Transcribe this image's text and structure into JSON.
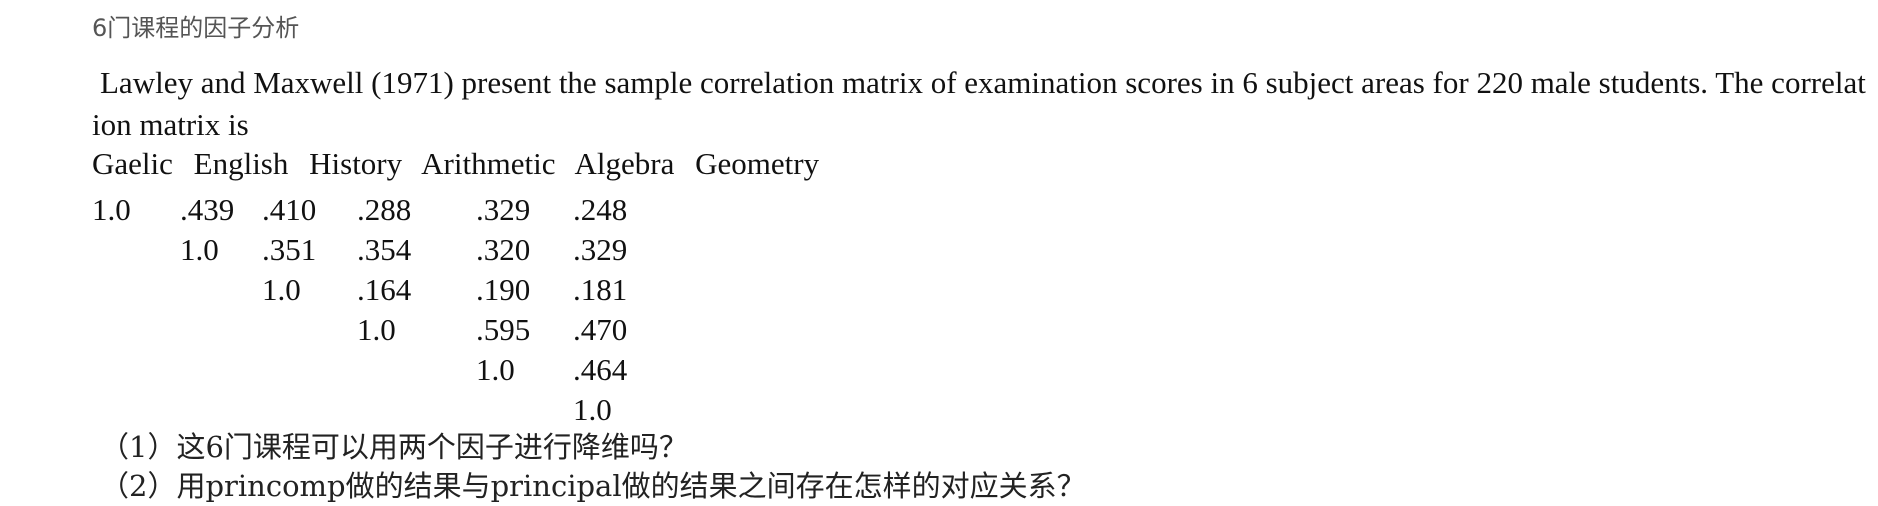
{
  "page_title": "6门课程的因子分析",
  "intro_text": " Lawley and Maxwell (1971) present the sample correlation matrix of examination scores in 6 subject areas for 220 male students. The correlation matrix is",
  "matrix": {
    "headers": [
      "Gaelic",
      "English",
      "History",
      "Arithmetic",
      "Algebra",
      "Geometry"
    ],
    "rows": [
      [
        "1.0",
        ".439",
        ".410",
        ".288",
        ".329",
        ".248"
      ],
      [
        "1.0",
        ".351",
        ".354",
        ".320",
        ".329"
      ],
      [
        "1.0",
        ".164",
        ".190",
        ".181"
      ],
      [
        "1.0",
        ".595",
        ".470"
      ],
      [
        "1.0",
        ".464"
      ],
      [
        "1.0"
      ]
    ]
  },
  "questions": [
    "（1）这6门课程可以用两个因子进行降维吗？",
    "（2）用princomp做的结果与principal做的结果之间存在怎样的对应关系？"
  ]
}
